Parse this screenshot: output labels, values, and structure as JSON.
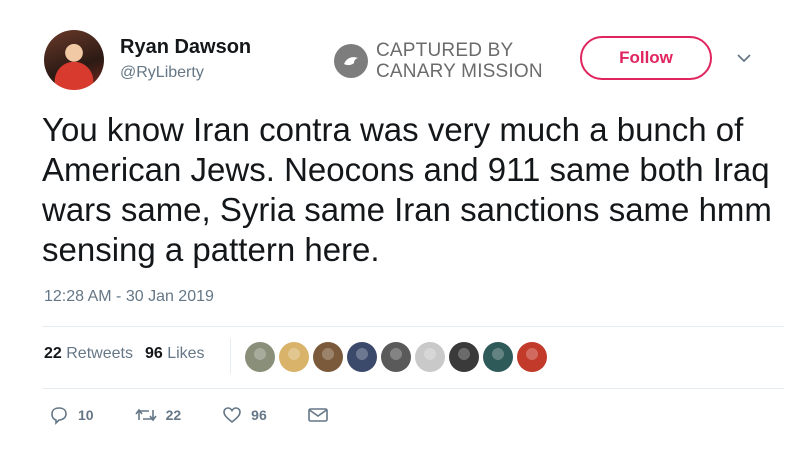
{
  "author": {
    "name": "Ryan Dawson",
    "handle": "@RyLiberty"
  },
  "watermark": {
    "line1": "CAPTURED BY",
    "line2": "CANARY MISSION"
  },
  "follow_label": "Follow",
  "tweet": {
    "text": "You know Iran contra was very much a bunch of American Jews. Neocons and 911 same both Iraq wars same, Syria same Iran sanctions same hmm sensing a pattern here.",
    "timestamp": "12:28 AM - 30 Jan 2019"
  },
  "stats": {
    "retweets_count": "22",
    "retweets_label": "Retweets",
    "likes_count": "96",
    "likes_label": "Likes"
  },
  "liker_colors": [
    "#8a8f7a",
    "#d9b36a",
    "#7a5a3a",
    "#3b4a6b",
    "#5a5a5a",
    "#c9c9c9",
    "#3a3a3a",
    "#2f5a5a",
    "#c23a2a"
  ],
  "actions": {
    "reply_count": "10",
    "retweet_count": "22",
    "like_count": "96"
  },
  "colors": {
    "accent": "#e0245e",
    "secondary_text": "#657786"
  }
}
